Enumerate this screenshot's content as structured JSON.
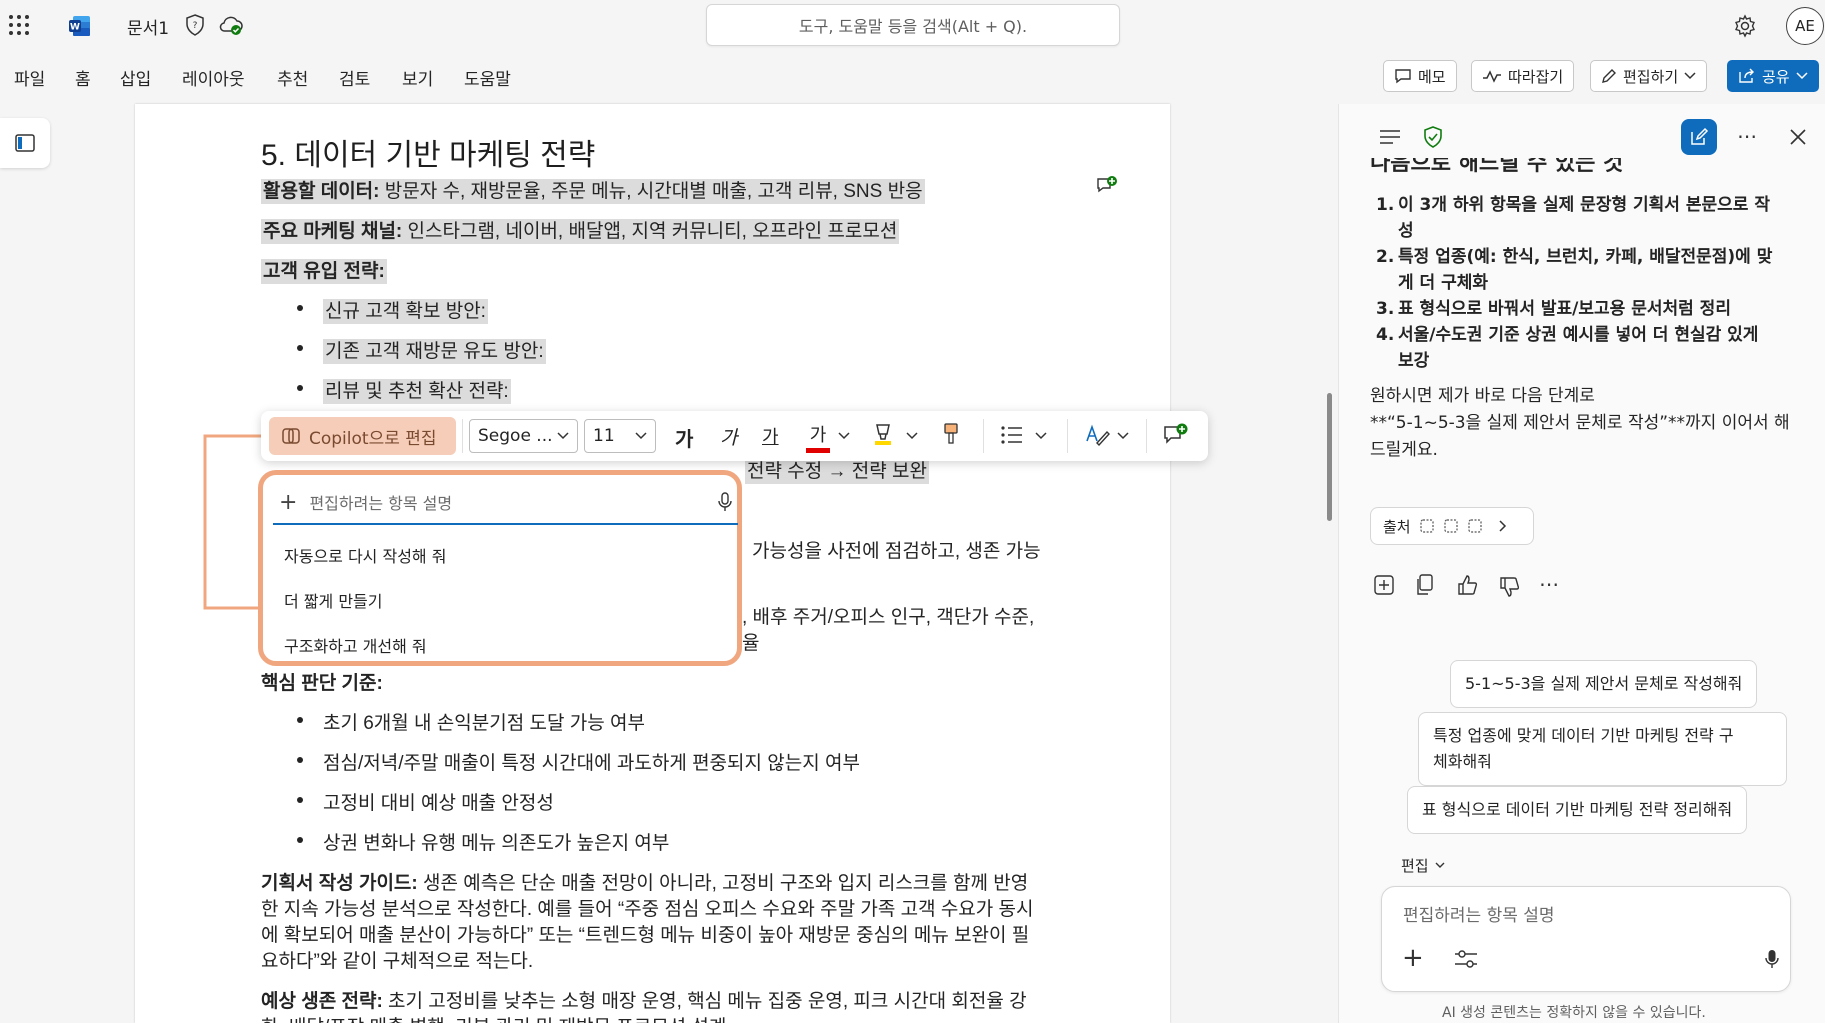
{
  "app": {
    "doc_title": "문서1",
    "avatar_initials": "AE",
    "accent_color": "#0f6cbd",
    "copilot_accent": "#f0a77f"
  },
  "search": {
    "placeholder": "도구, 도움말 등을 검색(Alt + Q)."
  },
  "ribbon": {
    "tabs": [
      "파일",
      "홈",
      "삽입",
      "레이아웃",
      "추천",
      "검토",
      "보기",
      "도움말"
    ],
    "memo": "메모",
    "follow": "따라잡기",
    "edit": "편집하기",
    "share": "공유"
  },
  "doc": {
    "heading": "5. 데이터 기반 마케팅 전략",
    "data_label": "활용할 데이터:",
    "data_text": " 방문자 수, 재방문율, 주문 메뉴, 시간대별 매출, 고객 리뷰, SNS 반응",
    "channel_label": "주요 마케팅 채널:",
    "channel_text": " 인스타그램, 네이버, 배달앱, 지역 커뮤니티, 오프라인 프로모션",
    "inflow_label": "고객 유입 전략:",
    "inflow_items": [
      "신규 고객 확보 방안:",
      "기존 고객 재방문 유도 방안:",
      "리뷰 및 추천 확산 전략:"
    ],
    "partial_line": "전략 수정 → 전략 보완",
    "partial_1a": "가능성을 사전에 점검하고, 생존 가능",
    "partial_2a": ", 배후 주거/오피스 인구, 객단가 수준,",
    "partial_2b": "율",
    "criteria_label": "핵심 판단 기준:",
    "criteria_items": [
      "초기 6개월 내 손익분기점 도달 가능 여부",
      "점심/저녁/주말 매출이 특정 시간대에 과도하게 편중되지 않는지 여부",
      "고정비 대비 예상 매출 안정성",
      "상권 변화나 유행 메뉴 의존도가 높은지 여부"
    ],
    "guide_label": "기획서 작성 가이드:",
    "guide_lines": [
      " 생존 예측은 단순 매출 전망이 아니라, 고정비 구조와 입지 리스크를 함께 반영",
      "한 지속 가능성 분석으로 작성한다. 예를 들어 “주중 점심 오피스 수요와 주말 가족 고객 수요가 동시",
      "에 확보되어 매출 분산이 가능하다” 또는 “트렌드형 메뉴 비중이 높아 재방문 중심의 메뉴 보완이 필",
      "요하다”와 같이 구체적으로 적는다."
    ],
    "survival_label": "예상 생존 전략:",
    "survival_line": " 초기 고정비를 낮추는 소형 매장 운영, 핵심 메뉴 집중 운영, 피크 시간대 회전율 강",
    "survival_line2": "화, 배달/포장 매출 병행, 리뷰 관리 및 재방문 프로모션 설계"
  },
  "toolbar": {
    "copilot_edit": "Copilot으로 편집",
    "font": "Segoe ...",
    "size": "11",
    "bold_glyph": "가",
    "italic_glyph": "가",
    "underline_glyph": "가",
    "color_glyph": "가"
  },
  "popup": {
    "placeholder": "편집하려는 항목 설명",
    "options": [
      "자동으로 다시 작성해 줘",
      "더 짧게 만들기",
      "구조화하고 개선해 줘"
    ]
  },
  "panel": {
    "cut_heading": "다음으로 해드릴 수 있는 것",
    "list": [
      [
        "이 3개 하위 항목을 실제 문장형 기획서 본문으로 작",
        "성"
      ],
      [
        "특정 업종(예: 한식, 브런치, 카페, 배달전문점)에 맞",
        "게 더 구체화"
      ],
      [
        "표 형식으로 바꿔서 발표/보고용 문서처럼 정리"
      ],
      [
        "서울/수도권 기준 상권 예시를 넣어 더 현실감 있게",
        "보강"
      ]
    ],
    "follow_lines": [
      "원하시면 제가 바로 다음 단계로",
      "**“5-1~5-3을 실제 제안서 문체로 작성”**까지 이어서 해",
      "드릴게요."
    ],
    "source": "출처",
    "suggestions": [
      "5-1~5-3을 실제 제안서 문체로 작성해줘",
      "특정 업종에 맞게 데이터 기반 마케팅 전략 구|체화해줘",
      "표 형식으로 데이터 기반 마케팅 전략 정리해줘"
    ],
    "mode": "편집",
    "chat_placeholder": "편집하려는 항목 설명",
    "disclaimer": "AI 생성 콘텐츠는 정확하지 않을 수 있습니다."
  }
}
